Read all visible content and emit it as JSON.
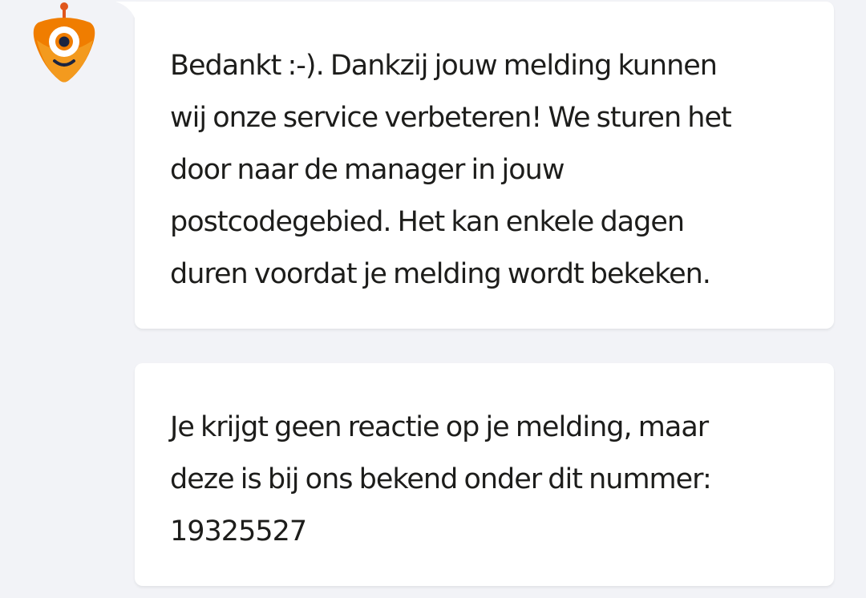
{
  "chat": {
    "bot_avatar": "orange-robot-avatar-icon",
    "messages": [
      {
        "sender": "bot",
        "text": "Bedankt :-). Dankzij jouw melding kunnen\nwij onze service verbeteren! We sturen het\ndoor naar de manager in jouw\npostcodegebied. Het kan enkele dagen\nduren voordat je melding wordt bekeken."
      },
      {
        "sender": "bot",
        "text": "Je krijgt geen reactie op je melding, maar\ndeze is bij ons bekend onder dit nummer:\n19325527"
      }
    ]
  },
  "colors": {
    "background": "#f2f3f7",
    "bubble": "#ffffff",
    "text": "#1d1d1b",
    "avatar_orange": "#f07d00",
    "avatar_dark_orange": "#e0561c",
    "avatar_eye_dark": "#1b2440"
  }
}
